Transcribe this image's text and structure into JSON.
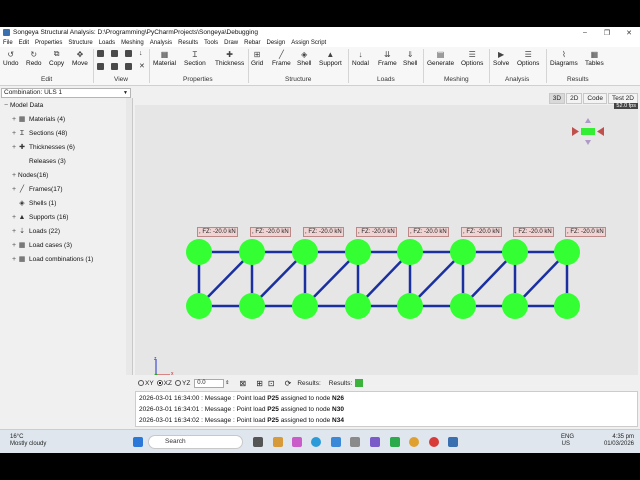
{
  "window": {
    "title": "Songeya Structural Analysis: D:\\Programming\\PyCharmProjects\\Songeya\\Debugging"
  },
  "menu": [
    "File",
    "Edit",
    "Properties",
    "Structure",
    "Loads",
    "Meshing",
    "Analysis",
    "Results",
    "Tools",
    "Draw",
    "Rebar",
    "Design",
    "Assign Script"
  ],
  "ribbon": {
    "edit": {
      "label": "Edit",
      "buttons": [
        "Undo",
        "Redo",
        "Copy",
        "Move"
      ]
    },
    "view": {
      "label": "View"
    },
    "properties": {
      "label": "Properties",
      "buttons": [
        "Material",
        "Section",
        "Thickness"
      ]
    },
    "structure": {
      "label": "Structure",
      "buttons": [
        "Grid",
        "Frame",
        "Shell",
        "Support"
      ]
    },
    "loads": {
      "label": "Loads",
      "buttons": [
        "Nodal",
        "Frame",
        "Shell"
      ]
    },
    "meshing": {
      "label": "Meshing",
      "buttons": [
        "Generate",
        "Options"
      ]
    },
    "analysis": {
      "label": "Analysis",
      "buttons": [
        "Solve",
        "Options"
      ]
    },
    "results": {
      "label": "Results",
      "buttons": [
        "Diagrams",
        "Tables"
      ]
    }
  },
  "combination": "Combination: ULS 1",
  "view_tabs": [
    "3D",
    "2D",
    "Code",
    "Test 2D"
  ],
  "fps": "52.0 fps",
  "tree": {
    "root": "Model Data",
    "items": [
      {
        "label": "Materials (4)",
        "icon": "materials-icon"
      },
      {
        "label": "Sections (48)",
        "icon": "section-icon"
      },
      {
        "label": "Thicknesses (6)",
        "icon": "thickness-icon"
      },
      {
        "label": "Releases (3)",
        "icon": ""
      },
      {
        "label": "Nodes(16)",
        "icon": ""
      },
      {
        "label": "Frames(17)",
        "icon": "frame-icon"
      },
      {
        "label": "Shells (1)",
        "icon": "shell-icon"
      },
      {
        "label": "Supports (16)",
        "icon": "support-icon"
      },
      {
        "label": "Loads (22)",
        "icon": "load-icon"
      },
      {
        "label": "Load cases (3)",
        "icon": "table-icon"
      },
      {
        "label": "Load combinations (1)",
        "icon": "table-icon"
      }
    ]
  },
  "load_label": "FZ: -20.0 kN",
  "axis": {
    "z": "z",
    "x": "x"
  },
  "bottom": {
    "planes": [
      "XY",
      "XZ",
      "YZ"
    ],
    "selected_plane": "XZ",
    "offset": "0.0",
    "results_label1": "Results:",
    "results_label2": "Results:",
    "results_color": "#3cb43c"
  },
  "log": [
    {
      "time": "2026-03-01 16:34:00",
      "msg": "Message : Point load",
      "load": "P25",
      "mid": "assigned to node",
      "node": "N26"
    },
    {
      "time": "2026-03-01 16:34:01",
      "msg": "Message : Point load",
      "load": "P25",
      "mid": "assigned to node",
      "node": "N30"
    },
    {
      "time": "2026-03-01 16:34:02",
      "msg": "Message : Point load",
      "load": "P25",
      "mid": "assigned to node",
      "node": "N34"
    }
  ],
  "taskbar": {
    "temp": "16°C",
    "weather": "Mostly cloudy",
    "search": "Search",
    "lang": "ENG",
    "region": "US",
    "time": "4:35 pm",
    "date": "01/03/2026"
  },
  "colors": {
    "node": "#33ff33",
    "member": "#1a2fa0",
    "canvas": "#e6e6e6"
  }
}
